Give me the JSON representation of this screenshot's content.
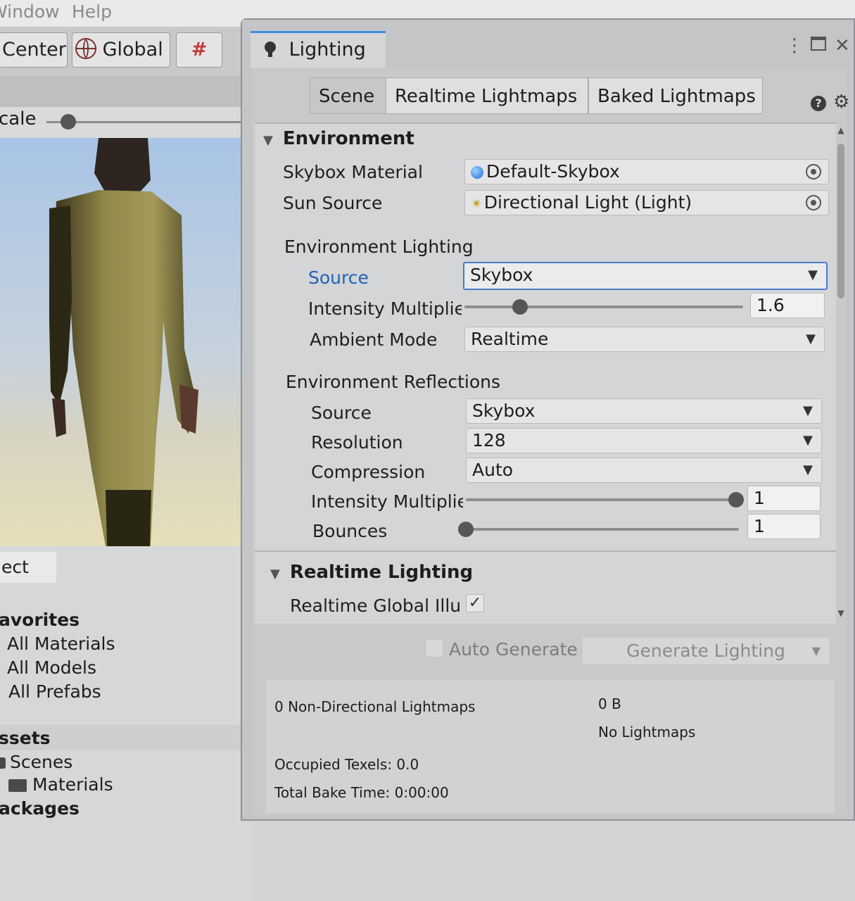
{
  "menu": {
    "window": "Window",
    "help": "Help"
  },
  "toolbar": {
    "pivot": "Center",
    "space": "Global"
  },
  "scene_view": {
    "scale_label": "cale"
  },
  "project": {
    "tab_label": "ect",
    "favorites_header": "avorites",
    "favorites": [
      "All Materials",
      "All Models",
      "All Prefabs"
    ],
    "assets_header": "ssets",
    "assets": [
      "Scenes",
      "Materials"
    ],
    "packages_header": "ackages"
  },
  "lighting": {
    "window_tab": "Lighting",
    "tabs": [
      "Scene",
      "Realtime Lightmaps",
      "Baked Lightmaps"
    ],
    "environment": {
      "header": "Environment",
      "skybox_material_label": "Skybox Material",
      "skybox_material_value": "Default-Skybox",
      "sun_source_label": "Sun Source",
      "sun_source_value": "Directional Light (Light)",
      "lighting_header": "Environment Lighting",
      "source_label": "Source",
      "source_value": "Skybox",
      "intensity_label": "Intensity Multiplie",
      "intensity_value": "1.6",
      "intensity_fraction": 0.2,
      "ambient_mode_label": "Ambient Mode",
      "ambient_mode_value": "Realtime",
      "reflections_header": "Environment Reflections",
      "refl_source_label": "Source",
      "refl_source_value": "Skybox",
      "resolution_label": "Resolution",
      "resolution_value": "128",
      "compression_label": "Compression",
      "compression_value": "Auto",
      "refl_intensity_label": "Intensity Multiplie",
      "refl_intensity_value": "1",
      "refl_intensity_fraction": 1.0,
      "bounces_label": "Bounces",
      "bounces_value": "1",
      "bounces_fraction": 0.0
    },
    "realtime": {
      "header": "Realtime Lighting",
      "gi_label": "Realtime Global Illui",
      "gi_checked": true
    },
    "bake": {
      "auto_generate_label": "Auto Generate",
      "generate_button": "Generate Lighting"
    },
    "stats": {
      "lightmaps": "0 Non-Directional Lightmaps",
      "size": "0 B",
      "no_lightmaps": "No Lightmaps",
      "occupied_texels": "Occupied Texels: 0.0",
      "bake_time": "Total Bake Time: 0:00:00"
    }
  }
}
